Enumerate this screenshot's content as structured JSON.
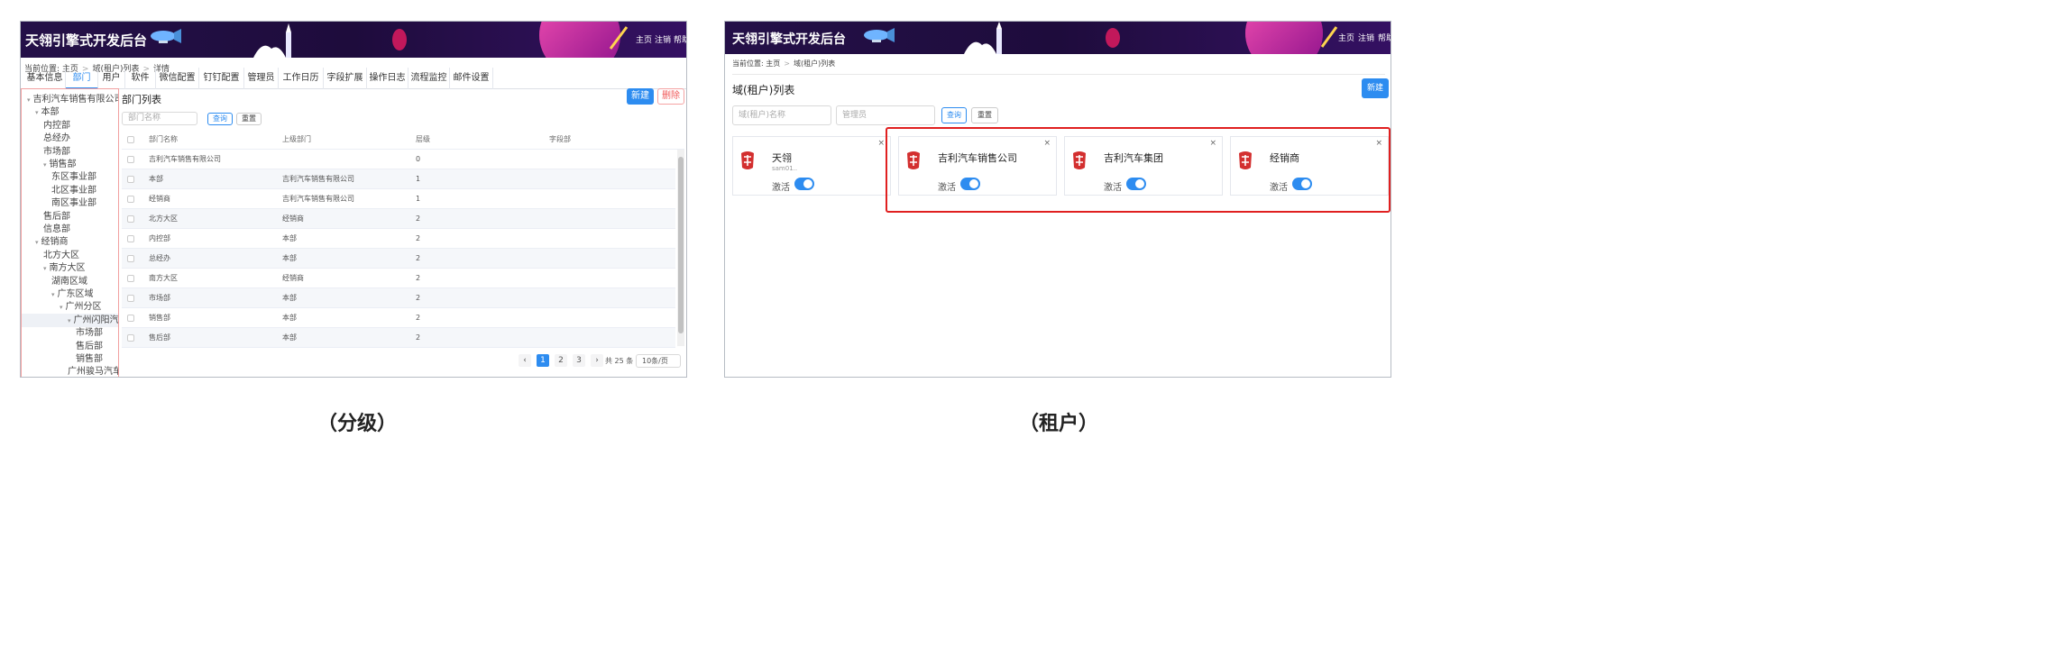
{
  "left": {
    "app_title": "天翎引擎式开发后台",
    "nav": [
      "主页",
      "注销",
      "帮助"
    ],
    "breadcrumb": [
      "当前位置: 主页",
      "域(租户)列表",
      "详情"
    ],
    "tabs": [
      "基本信息",
      "部门",
      "用户",
      "软件",
      "微信配置",
      "钉钉配置",
      "管理员",
      "工作日历",
      "字段扩展",
      "操作日志",
      "流程监控",
      "邮件设置"
    ],
    "active_tab": 1,
    "tree": [
      {
        "label": "吉利汽车销售有限公司",
        "level": 0,
        "caret": true
      },
      {
        "label": "本部",
        "level": 1,
        "caret": true
      },
      {
        "label": "内控部",
        "level": 2,
        "caret": false
      },
      {
        "label": "总经办",
        "level": 2,
        "caret": false
      },
      {
        "label": "市场部",
        "level": 2,
        "caret": false
      },
      {
        "label": "销售部",
        "level": 2,
        "caret": true
      },
      {
        "label": "东区事业部",
        "level": 3,
        "caret": false
      },
      {
        "label": "北区事业部",
        "level": 3,
        "caret": false
      },
      {
        "label": "南区事业部",
        "level": 3,
        "caret": false
      },
      {
        "label": "售后部",
        "level": 2,
        "caret": false
      },
      {
        "label": "信息部",
        "level": 2,
        "caret": false
      },
      {
        "label": "经销商",
        "level": 1,
        "caret": true
      },
      {
        "label": "北方大区",
        "level": 2,
        "caret": false
      },
      {
        "label": "南方大区",
        "level": 2,
        "caret": true
      },
      {
        "label": "湖南区域",
        "level": 3,
        "caret": false
      },
      {
        "label": "广东区域",
        "level": 3,
        "caret": true
      },
      {
        "label": "广州分区",
        "level": 4,
        "caret": true
      },
      {
        "label": "广州闪阳汽车",
        "level": 5,
        "caret": true,
        "selected": true
      },
      {
        "label": "市场部",
        "level": 6,
        "caret": false
      },
      {
        "label": "售后部",
        "level": 6,
        "caret": false
      },
      {
        "label": "销售部",
        "level": 6,
        "caret": false
      },
      {
        "label": "广州骏马汽车",
        "level": 5,
        "caret": false
      }
    ],
    "list_title": "部门列表",
    "btn_new": "新建",
    "btn_delete": "删除",
    "search_placeholder": "部门名称",
    "btn_query": "查询",
    "btn_reset": "重置",
    "columns": [
      "部门名称",
      "上级部门",
      "层级",
      "字段部"
    ],
    "rows": [
      [
        "吉利汽车销售有限公司",
        "",
        "0"
      ],
      [
        "本部",
        "吉利汽车销售有限公司",
        "1"
      ],
      [
        "经销商",
        "吉利汽车销售有限公司",
        "1"
      ],
      [
        "北方大区",
        "经销商",
        "2"
      ],
      [
        "内控部",
        "本部",
        "2"
      ],
      [
        "总经办",
        "本部",
        "2"
      ],
      [
        "南方大区",
        "经销商",
        "2"
      ],
      [
        "市场部",
        "本部",
        "2"
      ],
      [
        "销售部",
        "本部",
        "2"
      ],
      [
        "售后部",
        "本部",
        "2"
      ]
    ],
    "pages": [
      "1",
      "2",
      "3"
    ],
    "total": "共 25 条",
    "page_size": "10条/页"
  },
  "right": {
    "app_title": "天翎引擎式开发后台",
    "nav": [
      "主页",
      "注销",
      "帮助"
    ],
    "breadcrumb": [
      "当前位置: 主页",
      "域(租户)列表"
    ],
    "list_title": "域(租户)列表",
    "btn_new": "新建",
    "domain_placeholder": "域(租户)名称",
    "admin_placeholder": "管理员",
    "btn_query": "查询",
    "btn_reset": "重置",
    "cards": [
      {
        "name": "天翎",
        "sub": "sam01..",
        "active_label": "激活",
        "close": "×"
      },
      {
        "name": "吉利汽车销售公司",
        "sub": "",
        "active_label": "激活",
        "close": "×"
      },
      {
        "name": "吉利汽车集团",
        "sub": "",
        "active_label": "激活",
        "close": "×"
      },
      {
        "name": "经销商",
        "sub": "",
        "active_label": "激活",
        "close": "×"
      }
    ]
  },
  "captions": [
    "（分级）",
    "（租户）"
  ],
  "colors": {
    "accent": "#2d8cf0",
    "banner": "#241048",
    "highlight": "#e02020"
  }
}
